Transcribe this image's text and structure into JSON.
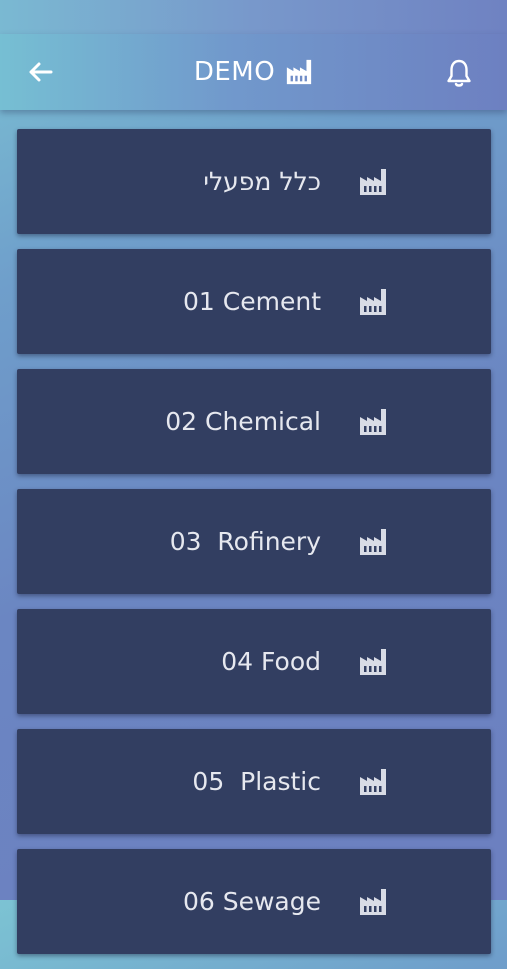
{
  "header": {
    "title": "DEMO",
    "back_icon": "arrow-left-icon",
    "title_icon": "factory-icon",
    "bell_icon": "bell-icon"
  },
  "plants": [
    {
      "label": "כלל מפעלי",
      "icon": "factory-icon"
    },
    {
      "label": "01 Cement",
      "icon": "factory-icon"
    },
    {
      "label": "02 Chemical",
      "icon": "factory-icon"
    },
    {
      "label": "03  Rofinery",
      "icon": "factory-icon"
    },
    {
      "label": "04 Food",
      "icon": "factory-icon"
    },
    {
      "label": "05  Plastic",
      "icon": "factory-icon"
    },
    {
      "label": "06 Sewage",
      "icon": "factory-icon"
    }
  ],
  "colors": {
    "card_bg": "#323e61",
    "card_text": "#e6e8ef",
    "header_text": "#ffffff"
  }
}
